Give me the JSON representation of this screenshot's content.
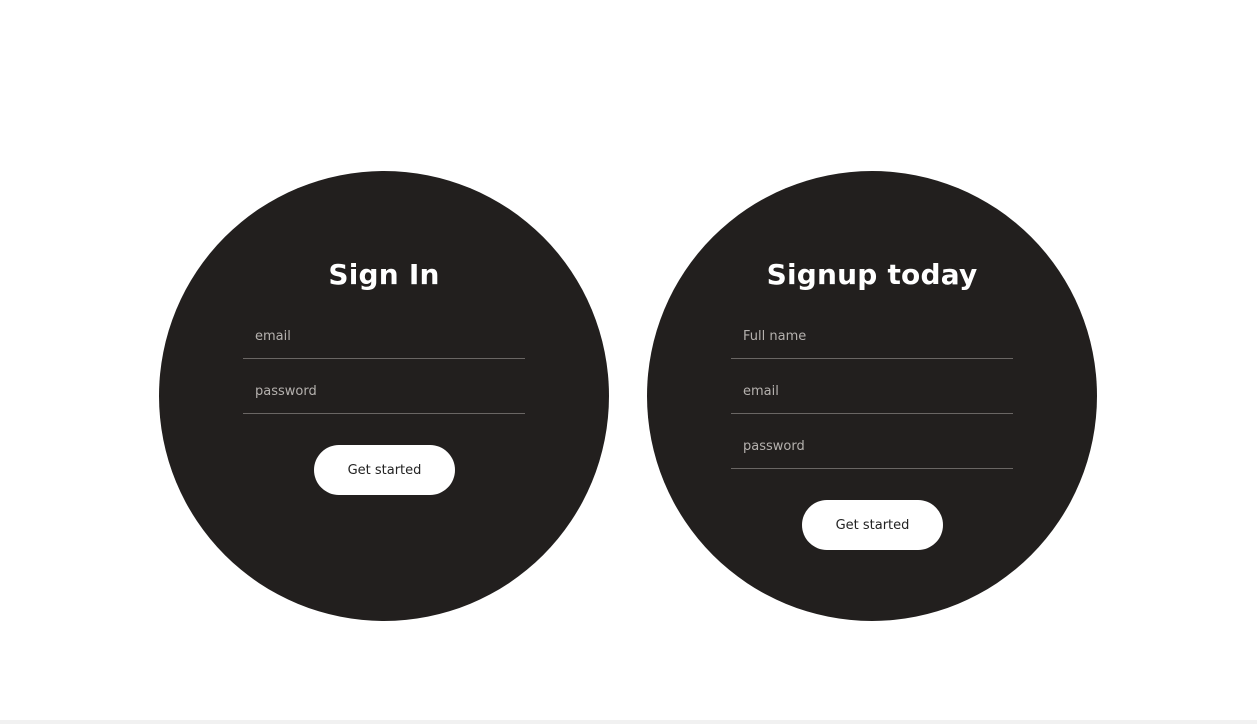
{
  "signin": {
    "title": "Sign In",
    "fields": [
      {
        "placeholder": "email",
        "value": ""
      },
      {
        "placeholder": "password",
        "value": ""
      }
    ],
    "button_label": "Get started"
  },
  "signup": {
    "title": "Signup today",
    "fields": [
      {
        "placeholder": "Full name",
        "value": ""
      },
      {
        "placeholder": "email",
        "value": ""
      },
      {
        "placeholder": "password",
        "value": ""
      }
    ],
    "button_label": "Get started"
  },
  "colors": {
    "page_background": "#ffffff",
    "card_background": "#221f1e",
    "text_primary": "#ffffff",
    "placeholder": "#b5b1ae",
    "field_underline": "#6a6664",
    "button_background": "#ffffff",
    "button_text": "#222222"
  }
}
